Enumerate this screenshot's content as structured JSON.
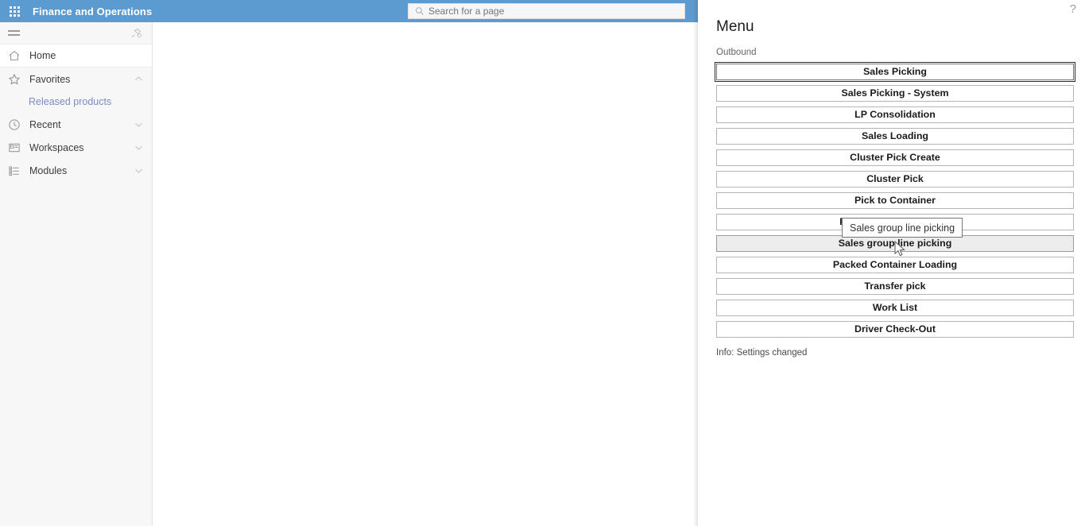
{
  "topbar": {
    "app_title": "Finance and Operations",
    "waffle_icon": "app-launcher-icon",
    "search_placeholder": "Search for a page",
    "search_value": "",
    "search_icon": "search-icon"
  },
  "leftnav": {
    "hamburger_icon": "hamburger-menu-icon",
    "pin_icon": "unpin-icon",
    "items": [
      {
        "label": "Home",
        "icon": "home-icon",
        "expandable": false,
        "state": ""
      },
      {
        "label": "Favorites",
        "icon": "star-icon",
        "expandable": true,
        "state": "expanded"
      },
      {
        "label": "Recent",
        "icon": "clock-icon",
        "expandable": true,
        "state": "collapsed"
      },
      {
        "label": "Workspaces",
        "icon": "workspaces-icon",
        "expandable": true,
        "state": "collapsed"
      },
      {
        "label": "Modules",
        "icon": "modules-icon",
        "expandable": true,
        "state": "collapsed"
      }
    ],
    "favorites_children": [
      {
        "label": "Released products"
      }
    ]
  },
  "rightpanel": {
    "help_icon": "help-question-icon",
    "title": "Menu",
    "group_label": "Outbound",
    "buttons": [
      {
        "label": "Sales Picking",
        "state": "focused"
      },
      {
        "label": "Sales Picking - System",
        "state": "normal"
      },
      {
        "label": "LP Consolidation",
        "state": "normal"
      },
      {
        "label": "Sales Loading",
        "state": "normal"
      },
      {
        "label": "Cluster Pick Create",
        "state": "normal"
      },
      {
        "label": "Cluster Pick",
        "state": "normal"
      },
      {
        "label": "Pick to Container",
        "state": "normal"
      },
      {
        "label": "Pick and Pack Shipping",
        "state": "normal"
      },
      {
        "label": "Sales group line picking",
        "state": "hovered"
      },
      {
        "label": "Packed Container Loading",
        "state": "normal"
      },
      {
        "label": "Transfer pick",
        "state": "normal"
      },
      {
        "label": "Work List",
        "state": "normal"
      },
      {
        "label": "Driver Check-Out",
        "state": "normal"
      }
    ],
    "info_text": "Info: Settings changed"
  },
  "tooltip": {
    "text": "Sales group line picking"
  },
  "colors": {
    "header_blue": "#5b9bd0",
    "sidebar_bg": "#f7f7f7",
    "link_blue": "#7a8cc4",
    "button_border": "#b5b5b5",
    "hover_bg": "#ededed"
  }
}
